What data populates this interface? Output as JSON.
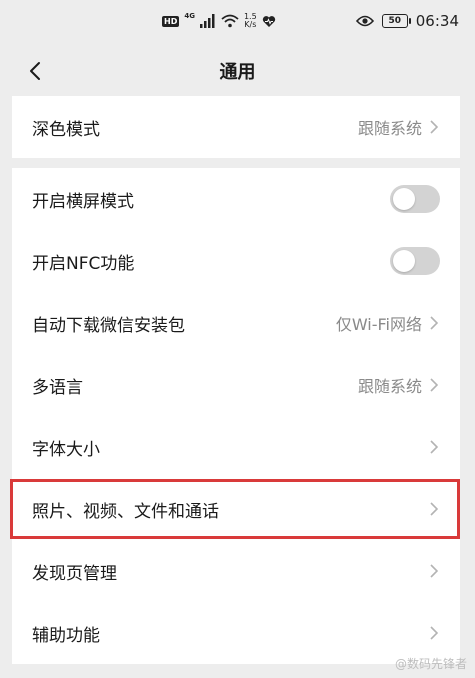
{
  "status_bar": {
    "hd": "HD",
    "network": "4G",
    "speed_value": "1.5",
    "speed_unit": "K/s",
    "battery": "50",
    "time": "06:34"
  },
  "header": {
    "title": "通用"
  },
  "group1": {
    "items": [
      {
        "label": "深色模式",
        "value": "跟随系统"
      }
    ]
  },
  "group2": {
    "items": [
      {
        "label": "开启横屏模式",
        "toggle": false
      },
      {
        "label": "开启NFC功能",
        "toggle": false
      },
      {
        "label": "自动下载微信安装包",
        "value": "仅Wi-Fi网络"
      },
      {
        "label": "多语言",
        "value": "跟随系统"
      },
      {
        "label": "字体大小",
        "value": ""
      },
      {
        "label": "照片、视频、文件和通话",
        "value": ""
      },
      {
        "label": "发现页管理",
        "value": ""
      },
      {
        "label": "辅助功能",
        "value": ""
      }
    ]
  },
  "highlight_color": "#d93a3a",
  "watermark": "@数码先锋者"
}
